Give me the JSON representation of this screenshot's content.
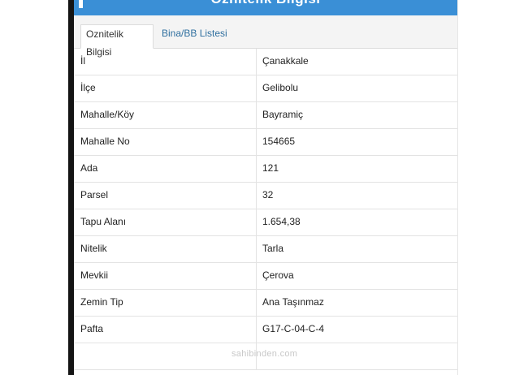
{
  "header": {
    "title": "Öznitelik Bilgisi"
  },
  "tabs": [
    {
      "label": "Oznitelik Bilgisi",
      "active": true
    },
    {
      "label": "Bina/BB Listesi",
      "active": false
    }
  ],
  "rows": [
    {
      "label": "İl",
      "value": "Çanakkale"
    },
    {
      "label": "İlçe",
      "value": "Gelibolu"
    },
    {
      "label": "Mahalle/Köy",
      "value": "Bayramiç"
    },
    {
      "label": "Mahalle No",
      "value": "154665"
    },
    {
      "label": "Ada",
      "value": "121"
    },
    {
      "label": "Parsel",
      "value": "32"
    },
    {
      "label": "Tapu Alanı",
      "value": "1.654,38"
    },
    {
      "label": "Nitelik",
      "value": "Tarla"
    },
    {
      "label": "Mevkii",
      "value": "Çerova"
    },
    {
      "label": "Zemin Tip",
      "value": "Ana Taşınmaz"
    },
    {
      "label": "Pafta",
      "value": "G17-C-04-C-4"
    }
  ],
  "watermark": "sahibinden.com",
  "colors": {
    "header_blue": "#3a8fd6",
    "tab_link": "#2f6f9f"
  }
}
